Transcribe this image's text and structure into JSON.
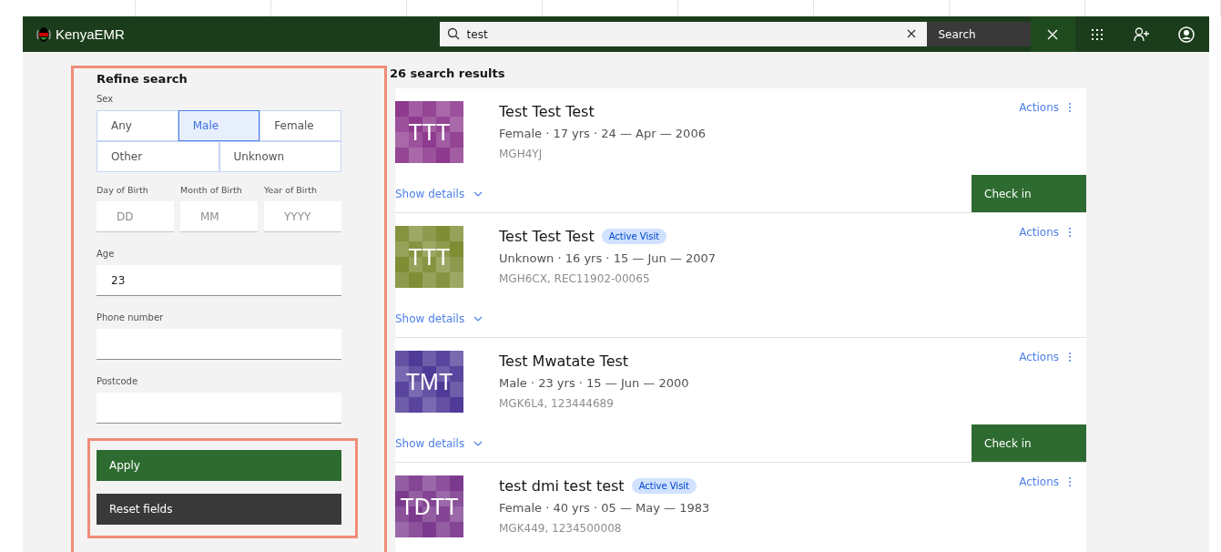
{
  "header": {
    "brand": "KenyaEMR",
    "search": {
      "value": "test"
    },
    "search_button": "Search"
  },
  "filters": {
    "title": "Refine search",
    "sex_label": "Sex",
    "sex_options": [
      [
        {
          "label": "Any",
          "selected": false
        },
        {
          "label": "Male",
          "selected": true
        },
        {
          "label": "Female",
          "selected": false
        }
      ],
      [
        {
          "label": "Other",
          "selected": false
        },
        {
          "label": "Unknown",
          "selected": false
        }
      ]
    ],
    "birth_fields": [
      {
        "label": "Day of Birth",
        "placeholder": "DD"
      },
      {
        "label": "Month of Birth",
        "placeholder": "MM"
      },
      {
        "label": "Year of Birth",
        "placeholder": "YYYY"
      }
    ],
    "fields": [
      {
        "label": "Age",
        "value": "23"
      },
      {
        "label": "Phone number"
      },
      {
        "label": "Postcode"
      }
    ],
    "apply": "Apply",
    "reset": "Reset fields"
  },
  "results": {
    "count": "26 search results",
    "patients": [
      {
        "initials": "TTT",
        "color": "#8e3a8e",
        "name": "Test Test Test",
        "details": "Female · 17 yrs · 24 — Apr — 2006",
        "ids": "MGH4YJ",
        "actions": "Actions",
        "show_details": "Show details",
        "check_in": "Check in"
      },
      {
        "initials": "TTT",
        "color": "#7f8d35",
        "name": "Test Test Test",
        "badge": "Active Visit",
        "details": "Unknown · 16 yrs · 15 — Jun — 2007",
        "ids": "MGH6CX, REC11902-00065",
        "actions": "Actions",
        "show_details": "Show details"
      },
      {
        "initials": "TMT",
        "color": "#4f3a97",
        "name": "Test Mwatate Test",
        "details": "Male · 23 yrs · 15 — Jun — 2000",
        "ids": "MGK6L4, 123444689",
        "actions": "Actions",
        "show_details": "Show details",
        "check_in": "Check in"
      },
      {
        "initials": "TDTT",
        "color": "#7c3a8e",
        "name": "test dmi test test",
        "badge": "Active Visit",
        "details": "Female · 40 yrs · 05 — May — 1983",
        "ids": "MGK449, 1234500008",
        "actions": "Actions"
      }
    ]
  }
}
